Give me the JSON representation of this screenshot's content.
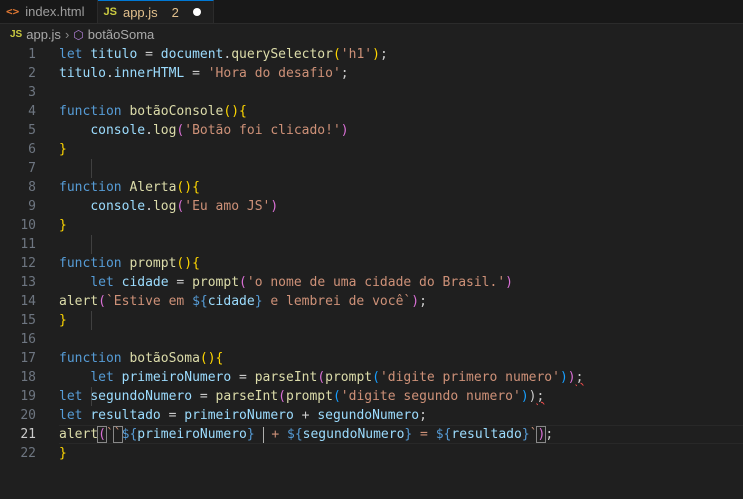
{
  "tabs": [
    {
      "icon": "html-file-icon",
      "glyph": "<>",
      "label": "index.html"
    },
    {
      "icon": "js-file-icon",
      "glyph": "JS",
      "label": "app.js",
      "count": "2"
    }
  ],
  "breadcrumb": {
    "file": "app.js",
    "symbol": "botãoSoma"
  },
  "colors": {
    "keyword": "#569cd6",
    "variable": "#9cdcfe",
    "function": "#dcdcaa",
    "string": "#ce9178",
    "accent": "#0078d4"
  },
  "current_line": 21,
  "lines": [
    [
      {
        "c": "kw",
        "t": "let "
      },
      {
        "c": "var",
        "t": "titulo"
      },
      {
        "c": "pl",
        "t": " = "
      },
      {
        "c": "var",
        "t": "document"
      },
      {
        "c": "pl",
        "t": "."
      },
      {
        "c": "fn",
        "t": "querySelector"
      },
      {
        "c": "br1",
        "t": "("
      },
      {
        "c": "str",
        "t": "'h1'"
      },
      {
        "c": "br1",
        "t": ")"
      },
      {
        "c": "pl",
        "t": ";"
      }
    ],
    [
      {
        "c": "var",
        "t": "titulo"
      },
      {
        "c": "pl",
        "t": "."
      },
      {
        "c": "var",
        "t": "innerHTML"
      },
      {
        "c": "pl",
        "t": " = "
      },
      {
        "c": "str",
        "t": "'Hora do desafio'"
      },
      {
        "c": "pl",
        "t": ";"
      }
    ],
    [],
    [
      {
        "c": "kw",
        "t": "function "
      },
      {
        "c": "fn",
        "t": "botãoConsole"
      },
      {
        "c": "br1",
        "t": "(){"
      }
    ],
    [
      {
        "c": "pl",
        "t": "    "
      },
      {
        "c": "var",
        "t": "console"
      },
      {
        "c": "pl",
        "t": "."
      },
      {
        "c": "fn",
        "t": "log"
      },
      {
        "c": "br2",
        "t": "("
      },
      {
        "c": "str",
        "t": "'Botão foi clicado!'"
      },
      {
        "c": "br2",
        "t": ")"
      }
    ],
    [
      {
        "c": "br1",
        "t": "}"
      }
    ],
    [],
    [
      {
        "c": "kw",
        "t": "function "
      },
      {
        "c": "fn",
        "t": "Alerta"
      },
      {
        "c": "br1",
        "t": "(){"
      }
    ],
    [
      {
        "c": "pl",
        "t": "    "
      },
      {
        "c": "var",
        "t": "console"
      },
      {
        "c": "pl",
        "t": "."
      },
      {
        "c": "fn",
        "t": "log"
      },
      {
        "c": "br2",
        "t": "("
      },
      {
        "c": "str",
        "t": "'Eu amo JS'"
      },
      {
        "c": "br2",
        "t": ")"
      }
    ],
    [
      {
        "c": "br1",
        "t": "}"
      }
    ],
    [],
    [
      {
        "c": "kw",
        "t": "function "
      },
      {
        "c": "fn",
        "t": "prompt"
      },
      {
        "c": "br1",
        "t": "(){"
      }
    ],
    [
      {
        "c": "pl",
        "t": "    "
      },
      {
        "c": "kw",
        "t": "let "
      },
      {
        "c": "var",
        "t": "cidade"
      },
      {
        "c": "pl",
        "t": " = "
      },
      {
        "c": "fn",
        "t": "prompt"
      },
      {
        "c": "br2",
        "t": "("
      },
      {
        "c": "str",
        "t": "'o nome de uma cidade do Brasil.'"
      },
      {
        "c": "br2",
        "t": ")"
      }
    ],
    [
      {
        "c": "fn",
        "t": "alert"
      },
      {
        "c": "br2",
        "t": "("
      },
      {
        "c": "str",
        "t": "`Estive em "
      },
      {
        "c": "tpl",
        "t": "${"
      },
      {
        "c": "var",
        "t": "cidade"
      },
      {
        "c": "tpl",
        "t": "}"
      },
      {
        "c": "str",
        "t": " e lembrei de você`"
      },
      {
        "c": "br2",
        "t": ")"
      },
      {
        "c": "pl",
        "t": ";"
      }
    ],
    [
      {
        "c": "br1",
        "t": "}"
      }
    ],
    [],
    [
      {
        "c": "kw",
        "t": "function "
      },
      {
        "c": "fn",
        "t": "botãoSoma"
      },
      {
        "c": "br1",
        "t": "(){"
      }
    ],
    [
      {
        "c": "pl",
        "t": "    "
      },
      {
        "c": "kw",
        "t": "let "
      },
      {
        "c": "var",
        "t": "primeiroNumero"
      },
      {
        "c": "pl",
        "t": " = "
      },
      {
        "c": "fn",
        "t": "parseInt"
      },
      {
        "c": "br2",
        "t": "("
      },
      {
        "c": "fn",
        "t": "prompt"
      },
      {
        "c": "br3",
        "t": "("
      },
      {
        "c": "str",
        "t": "'digite primero numero'"
      },
      {
        "c": "br3",
        "t": ")"
      },
      {
        "c": "br2",
        "t": ")"
      },
      {
        "c": "pl squig",
        "t": ";"
      }
    ],
    [
      {
        "c": "kw",
        "t": "let "
      },
      {
        "c": "var",
        "t": "segundoNumero"
      },
      {
        "c": "pl",
        "t": " = "
      },
      {
        "c": "fn",
        "t": "parseInt"
      },
      {
        "c": "br2",
        "t": "("
      },
      {
        "c": "fn",
        "t": "prompt"
      },
      {
        "c": "br3",
        "t": "("
      },
      {
        "c": "str",
        "t": "'digite segundo numero'"
      },
      {
        "c": "br3",
        "t": ")"
      },
      {
        "c": "pl",
        "t": ")"
      },
      {
        "c": "pl squig",
        "t": ";"
      }
    ],
    [
      {
        "c": "kw",
        "t": "let "
      },
      {
        "c": "var",
        "t": "resultado"
      },
      {
        "c": "pl",
        "t": " = "
      },
      {
        "c": "var",
        "t": "primeiroNumero"
      },
      {
        "c": "pl",
        "t": " + "
      },
      {
        "c": "var",
        "t": "segundoNumero"
      },
      {
        "c": "pl",
        "t": ";"
      }
    ],
    [
      {
        "c": "fn",
        "t": "alert"
      },
      {
        "c": "br2 match",
        "t": "("
      },
      {
        "c": "str",
        "t": "`"
      },
      {
        "c": "str match",
        "t": "`"
      },
      {
        "c": "tpl",
        "t": "${"
      },
      {
        "c": "var",
        "t": "primeiroNumero"
      },
      {
        "c": "tpl",
        "t": "}"
      },
      {
        "c": "str",
        "t": " "
      },
      {
        "c": "cursor",
        "t": ""
      },
      {
        "c": "str",
        "t": " + "
      },
      {
        "c": "tpl",
        "t": "${"
      },
      {
        "c": "var",
        "t": "segundoNumero"
      },
      {
        "c": "tpl",
        "t": "}"
      },
      {
        "c": "str",
        "t": " = "
      },
      {
        "c": "tpl",
        "t": "${"
      },
      {
        "c": "var",
        "t": "resultado"
      },
      {
        "c": "tpl",
        "t": "}"
      },
      {
        "c": "str",
        "t": "`"
      },
      {
        "c": "br2 match",
        "t": ")"
      },
      {
        "c": "pl",
        "t": ";"
      }
    ],
    [
      {
        "c": "br1",
        "t": "}"
      }
    ]
  ]
}
